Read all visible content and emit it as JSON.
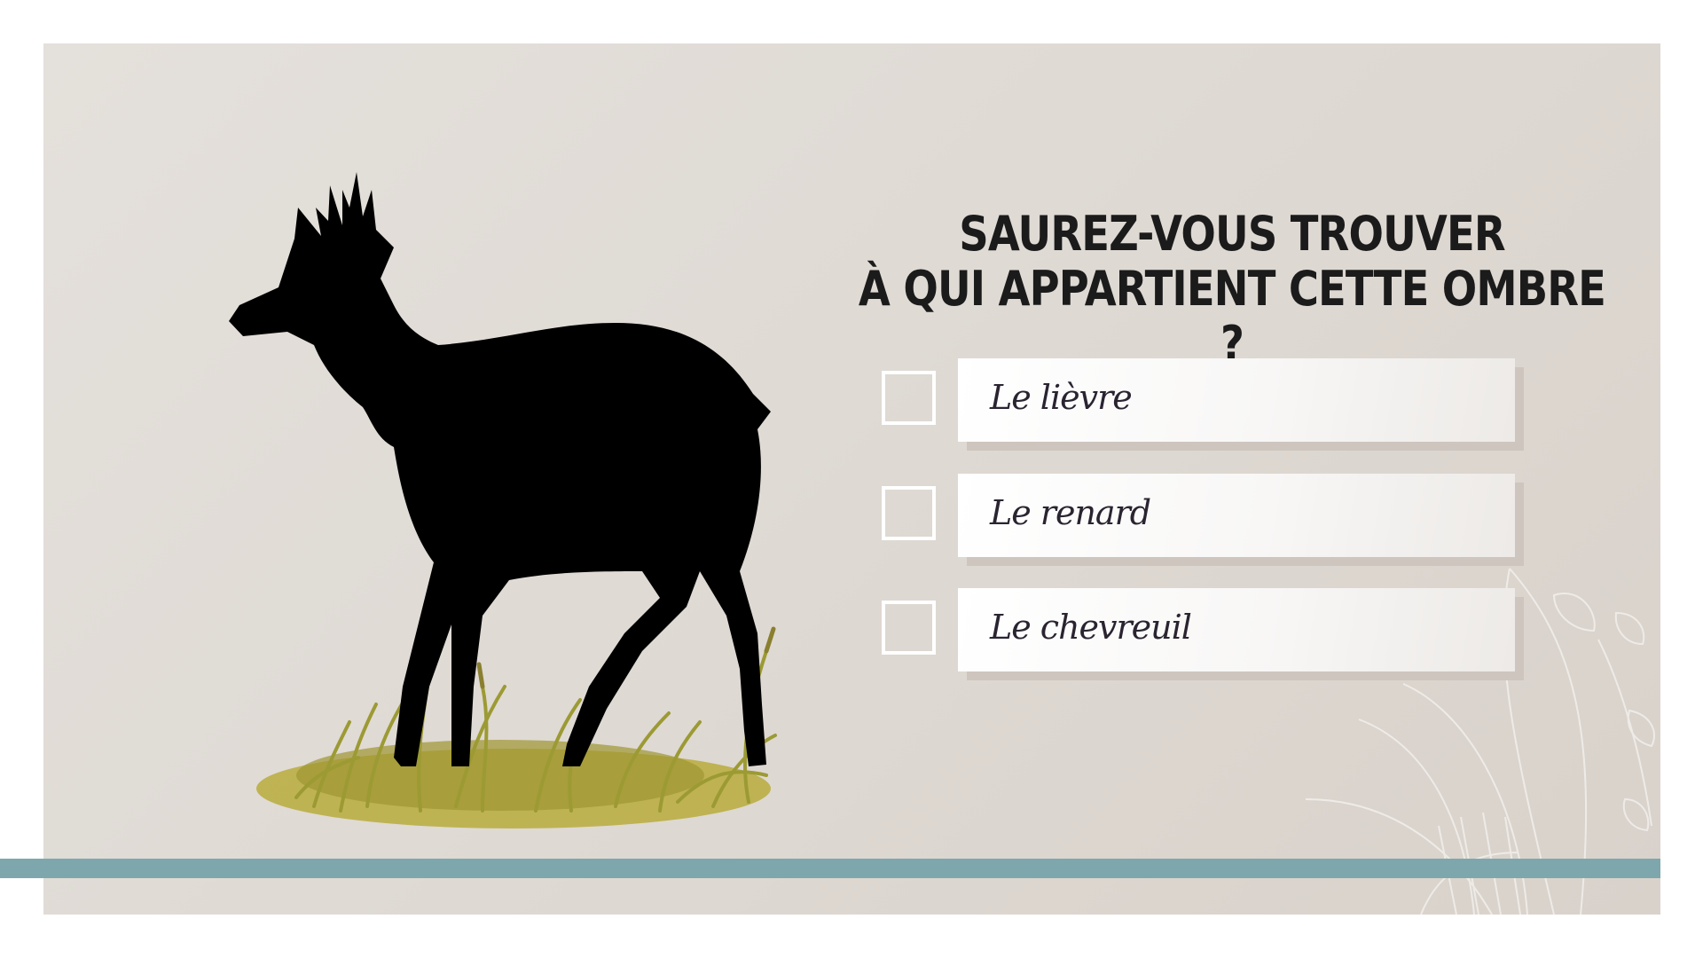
{
  "quiz": {
    "title_line1": "SAUREZ-VOUS TROUVER",
    "title_line2": "À QUI APPARTIENT CETTE OMBRE ?",
    "options": [
      {
        "label": "Le lièvre",
        "checked": false
      },
      {
        "label": "Le renard",
        "checked": false
      },
      {
        "label": "Le chevreuil",
        "checked": false
      }
    ]
  },
  "illustration": {
    "subject": "roe-deer-silhouette-icon",
    "ground": "grass-tuft-icon"
  },
  "colors": {
    "background": "#e2ded9",
    "accent_bar": "#7ea7ad",
    "title_text": "#1b1b1b",
    "answer_text": "#2a2431",
    "silhouette": "#000000",
    "grass": "#b7a93a"
  }
}
